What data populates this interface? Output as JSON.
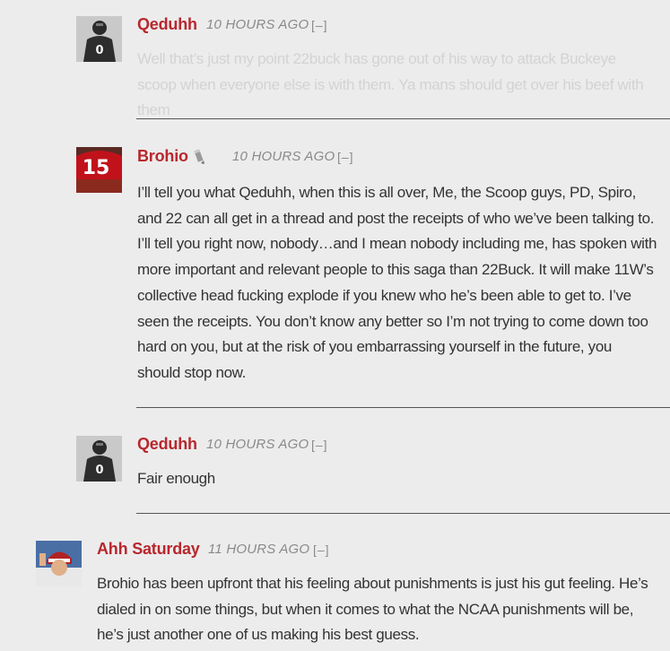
{
  "colors": {
    "author": "#b8272d",
    "timestamp": "#8a8a8a",
    "body_text": "#333333",
    "faded_text": "#d3d3d3",
    "background": "#ececec"
  },
  "comments": [
    {
      "author": "Qeduhh",
      "time": "10 HOURS AGO",
      "collapse": "[–]",
      "avatar": "jersey-0-avatar",
      "text": "Well that’s just my point 22buck has gone out of his way to attack Buckeye scoop when everyone else is with them. Ya mans should get over his beef with them"
    },
    {
      "author": "Brohio",
      "badge": "pencil-badge-icon",
      "time": "10 HOURS AGO",
      "collapse": "[–]",
      "avatar": "jersey-15-avatar",
      "text": "I’ll tell you what Qeduhh, when this is all over, Me, the Scoop guys, PD, Spiro, and 22 can all get in a thread and post the receipts of who we’ve been talking to. I’ll tell you right now, nobody…and I mean nobody including me, has spoken with more important and relevant people to this saga than 22Buck. It will make 11W’s collective head fucking explode if you knew who he’s been able to get to. I’ve seen the receipts. You don’t know any better so I’m not trying to come down too hard on you, but at the risk of you embarrassing yourself in the future, you should stop now."
    },
    {
      "author": "Qeduhh",
      "time": "10 HOURS AGO",
      "collapse": "[–]",
      "avatar": "jersey-0-avatar",
      "text": "Fair enough"
    },
    {
      "author": "Ahh Saturday",
      "time": "11 HOURS AGO",
      "collapse": "[–]",
      "avatar": "helmet-fan-avatar",
      "text": "Brohio has been upfront that his feeling about punishments is just his gut feeling. He’s dialed in on some things, but when it comes to what the NCAA punishments will be,  he’s just another one of us making his best guess."
    }
  ]
}
